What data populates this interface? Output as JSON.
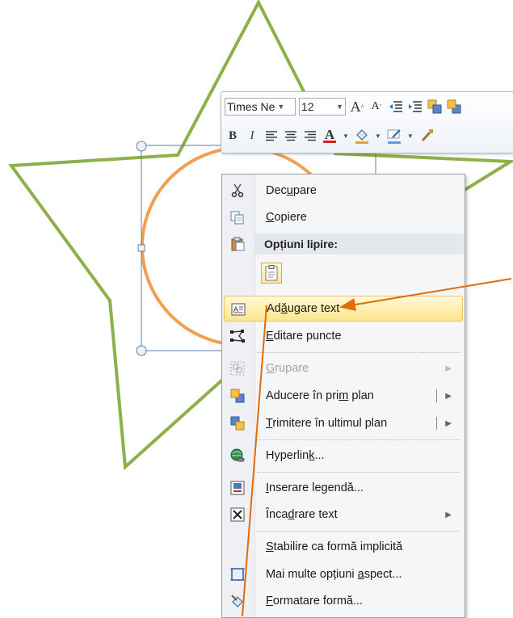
{
  "mini_toolbar": {
    "font_name": "Times Ne",
    "font_size": "12",
    "bold": "B",
    "italic": "I",
    "grow_font": "A",
    "shrink_font": "A",
    "font_color_glyph": "A"
  },
  "context_menu": {
    "items": [
      {
        "pre": "Dec",
        "ul": "u",
        "post": "pare",
        "icon": "scissors-icon",
        "disabled": false
      },
      {
        "pre": "",
        "ul": "C",
        "post": "opiere",
        "icon": "copy-icon",
        "disabled": false
      },
      {
        "pre": "",
        "ul": "",
        "post": "Opțiuni lipire:",
        "icon": "paste-icon",
        "disabled": false
      },
      {
        "pre": "Ad",
        "ul": "ă",
        "post": "ugare text",
        "icon": "textbox-icon",
        "disabled": false
      },
      {
        "pre": "",
        "ul": "E",
        "post": "ditare puncte",
        "icon": "edit-points-icon",
        "disabled": false
      },
      {
        "pre": "",
        "ul": "G",
        "post": "rupare",
        "icon": "group-icon",
        "disabled": true
      },
      {
        "pre": "Aducere în pri",
        "ul": "m",
        "post": " plan",
        "icon": "bring-forward-icon",
        "disabled": false
      },
      {
        "pre": "",
        "ul": "T",
        "post": "rimitere în ultimul plan",
        "icon": "send-backward-icon",
        "disabled": false
      },
      {
        "pre": "Hyperlin",
        "ul": "k",
        "post": "...",
        "icon": "hyperlink-icon",
        "disabled": false
      },
      {
        "pre": "",
        "ul": "I",
        "post": "nserare legendă...",
        "icon": "caption-icon",
        "disabled": false
      },
      {
        "pre": "Înca",
        "ul": "d",
        "post": "rare text",
        "icon": "wrap-text-icon",
        "disabled": false
      },
      {
        "pre": "",
        "ul": "S",
        "post": "tabilire ca formă implicită",
        "icon": "",
        "disabled": false
      },
      {
        "pre": "Mai multe opțiuni ",
        "ul": "a",
        "post": "spect...",
        "icon": "layout-options-icon",
        "disabled": false
      },
      {
        "pre": "",
        "ul": "F",
        "post": "ormatare formă...",
        "icon": "format-shape-icon",
        "disabled": false
      }
    ]
  },
  "colors": {
    "star_outline": "#8cb04a",
    "ellipse_outline": "#f0a050",
    "annotation_arrow": "#e36c0a",
    "highlight": "#fde58a",
    "selection_frame": "#5a7fa8"
  }
}
